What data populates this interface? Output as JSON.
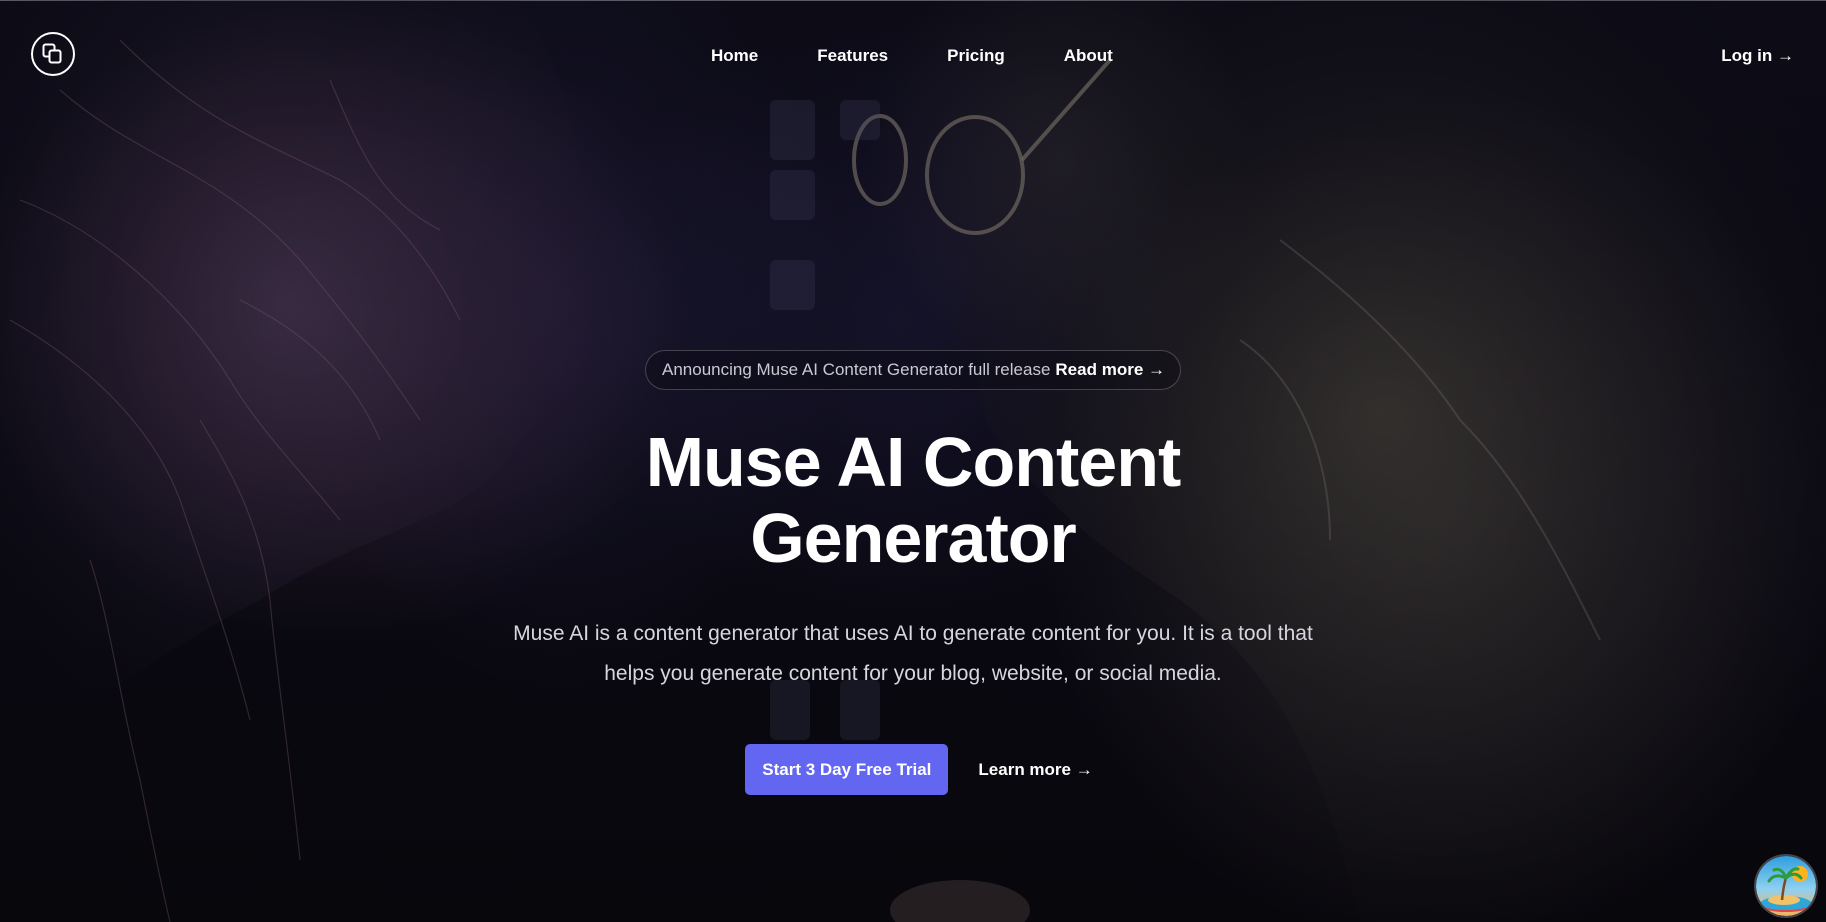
{
  "nav": {
    "logo_icon": "stacked-squares-logo-icon",
    "links": [
      {
        "label": "Home"
      },
      {
        "label": "Features"
      },
      {
        "label": "Pricing"
      },
      {
        "label": "About"
      }
    ],
    "login_label": "Log in →"
  },
  "hero": {
    "announcement_text": "Announcing Muse AI Content Generator full release",
    "announcement_link": "Read more →",
    "title": "Muse AI Content Generator",
    "subtitle": "Muse AI is a content generator that uses AI to generate content for you. It is a tool that helps you generate content for your blog, website, or social media.",
    "primary_cta": "Start 3 Day Free Trial",
    "secondary_cta": "Learn more →"
  },
  "floating_widget": {
    "icon": "tropical-island-icon"
  },
  "colors": {
    "accent": "#6366f1",
    "background": "#0a0912",
    "text": "#ffffff",
    "muted_text": "#d6d6df"
  }
}
